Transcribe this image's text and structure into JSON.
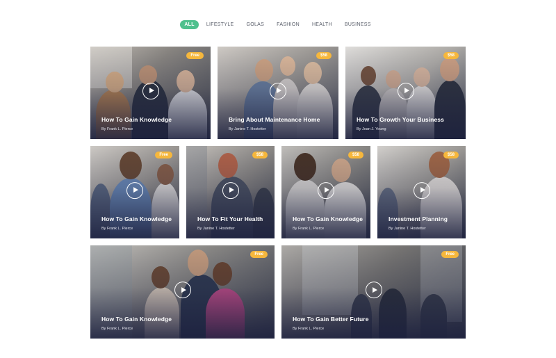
{
  "filters": [
    "ALL",
    "LIFESTYLE",
    "GOLAS",
    "FASHION",
    "HEALTH",
    "BUSINESS"
  ],
  "active_filter": "ALL",
  "colors": {
    "accent": "#4fc08d",
    "badge": "#f6b73c",
    "overlay": "#1c203e"
  },
  "cards": [
    {
      "title": "How To Gain Knowledge",
      "author": "By Frank L. Pierce",
      "badge": "Free"
    },
    {
      "title": "Bring About Maintenance Home",
      "author": "By Janine T. Hostetter",
      "badge": "$58"
    },
    {
      "title": "How To Growth Your Business",
      "author": "By Joan J. Young",
      "badge": "$58"
    },
    {
      "title": "How To Gain Knowledge",
      "author": "By Frank L. Pierce",
      "badge": "Free"
    },
    {
      "title": "How To Fit Your Health",
      "author": "By Janine T. Hostetter",
      "badge": "$58"
    },
    {
      "title": "How To Gain Knowledge",
      "author": "By Frank L. Pierce",
      "badge": "$58"
    },
    {
      "title": "Investment Planning",
      "author": "By Janine T. Hostetter",
      "badge": "$58"
    },
    {
      "title": "How To Gain Knowledge",
      "author": "By Frank L. Pierce",
      "badge": "Free"
    },
    {
      "title": "How To Gain Better Future",
      "author": "By Frank L. Pierce",
      "badge": "Free"
    }
  ]
}
